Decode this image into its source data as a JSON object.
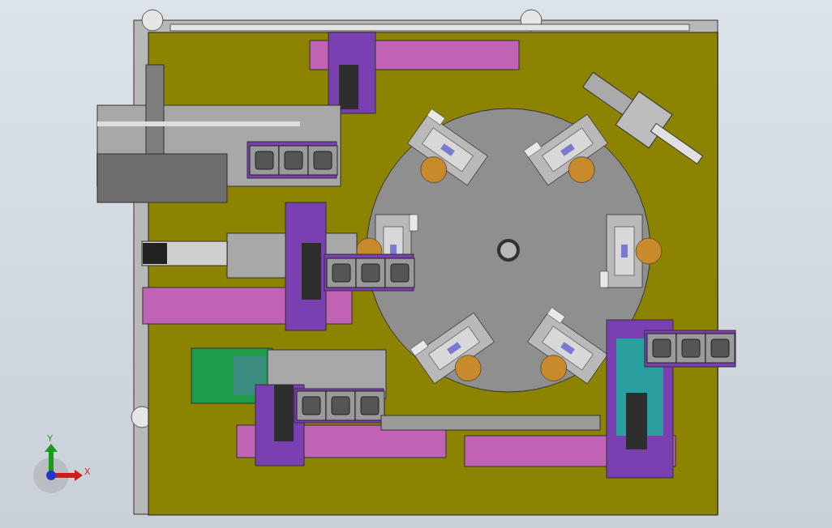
{
  "triad": {
    "y_label": "Y",
    "x_label": "X"
  }
}
